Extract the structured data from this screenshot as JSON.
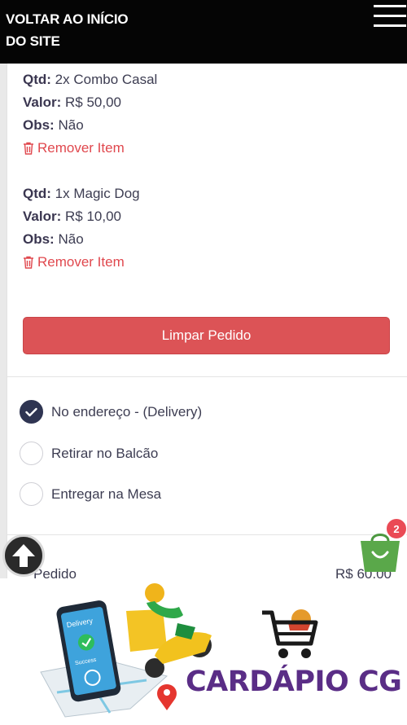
{
  "header": {
    "back_label": "VOLTAR AO INÍCIO DO SITE",
    "menu_icon": "hamburger-menu-icon"
  },
  "cart_items": [
    {
      "qty_label": "Qtd:",
      "qty_value": "2x Combo Casal",
      "price_label": "Valor:",
      "price_value": "R$ 50,00",
      "obs_label": "Obs:",
      "obs_value": "Não",
      "remove_label": "Remover Item"
    },
    {
      "qty_label": "Qtd:",
      "qty_value": "1x Magic Dog",
      "price_label": "Valor:",
      "price_value": "R$ 10,00",
      "obs_label": "Obs:",
      "obs_value": "Não",
      "remove_label": "Remover Item"
    }
  ],
  "clear_button_label": "Limpar Pedido",
  "delivery_options": [
    {
      "label": "No endereço - (Delivery)",
      "selected": true
    },
    {
      "label": "Retirar no Balcão",
      "selected": false
    },
    {
      "label": "Entregar na Mesa",
      "selected": false
    }
  ],
  "summary": {
    "label": "Pedido",
    "value": "R$ 60,00"
  },
  "cart_badge_count": "2",
  "banner": {
    "phone_text_top": "Delivery",
    "phone_text_bottom": "Success",
    "brand_name": "CARDÁPIO CG"
  },
  "colors": {
    "header_bg": "#050505",
    "danger": "#dc5356",
    "radio_checked": "#2f3552",
    "cart_green": "#5aa84a",
    "brand_purple": "#5a2d86"
  }
}
